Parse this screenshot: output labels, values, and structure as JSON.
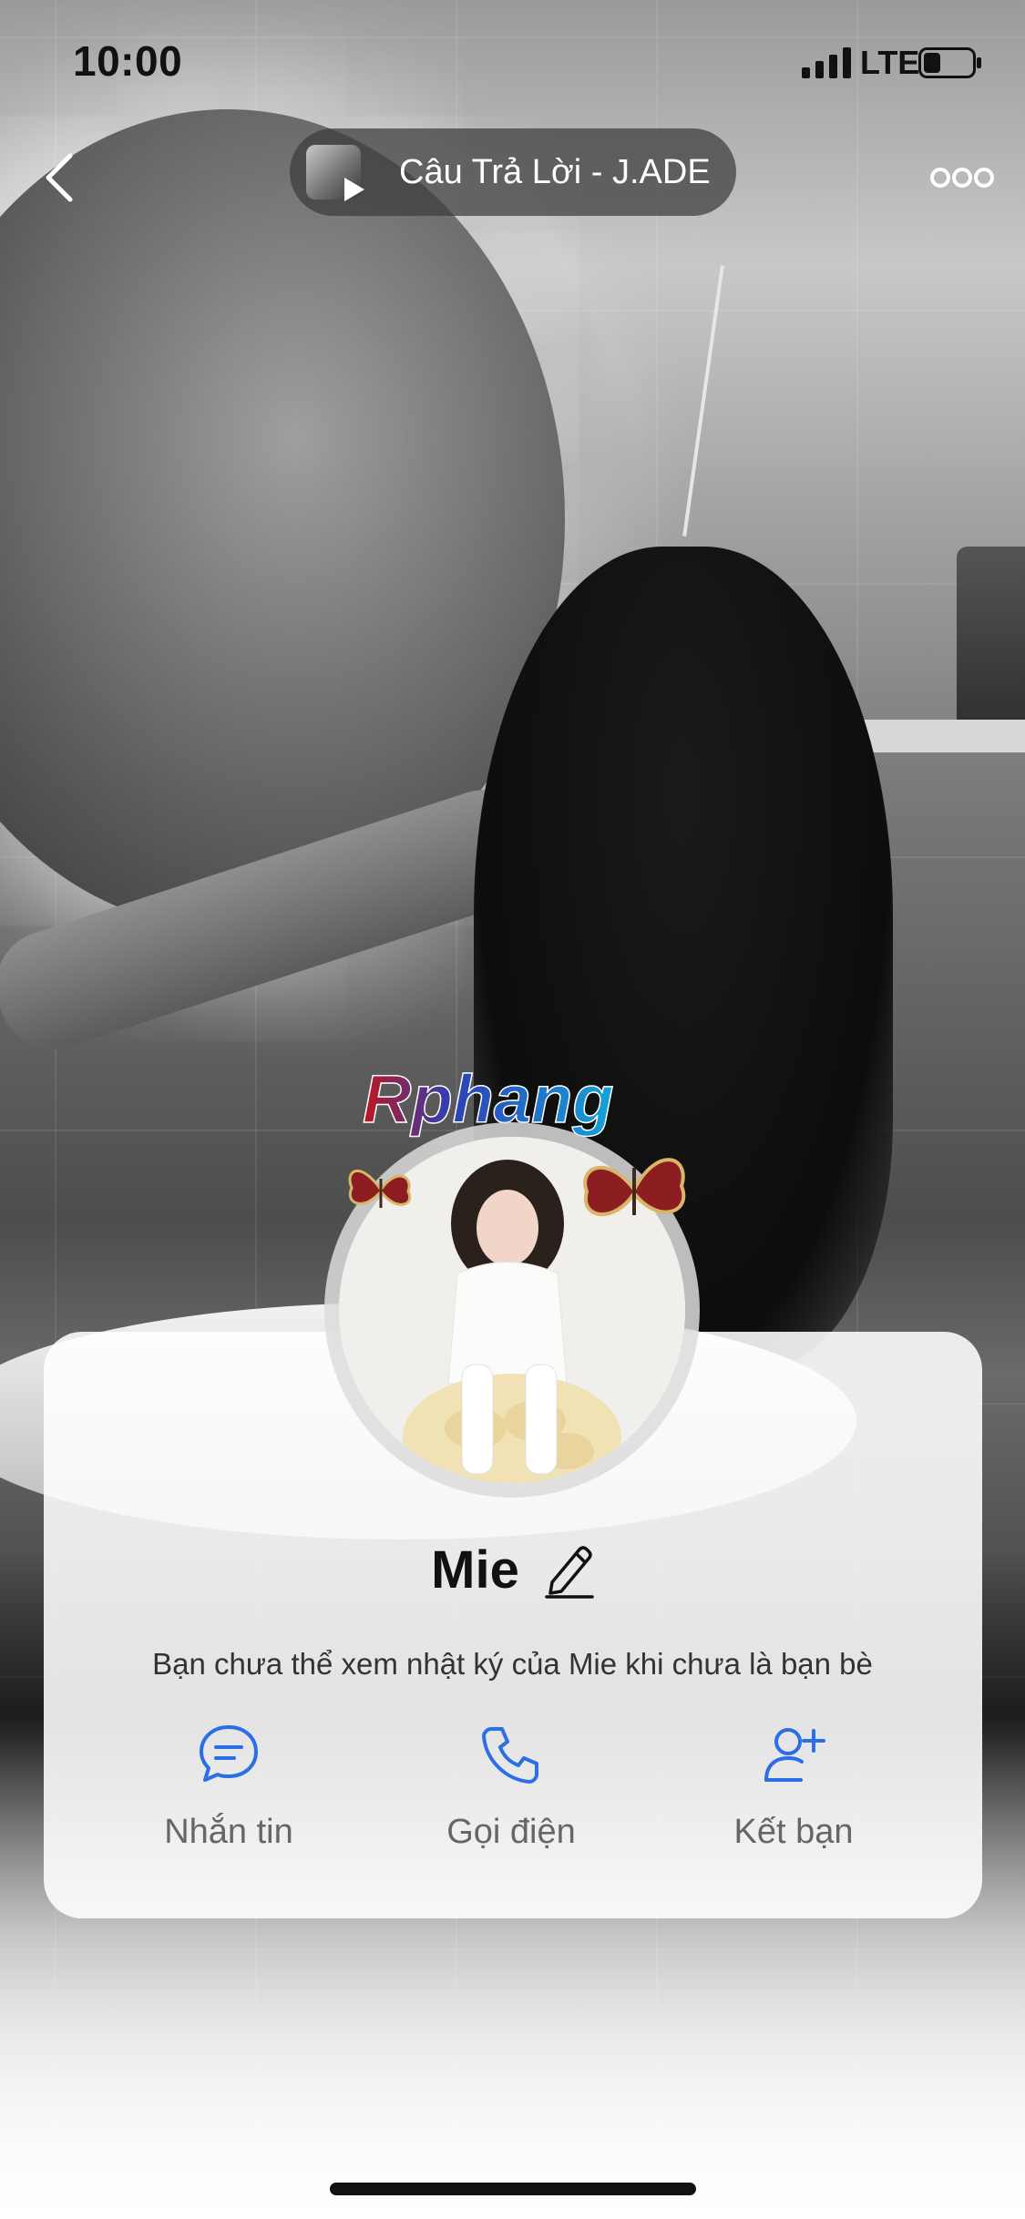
{
  "status_bar": {
    "time": "10:00",
    "network": "LTE",
    "signal_icon": "signal-bars-icon",
    "battery_icon": "battery-icon",
    "battery_level": 0.35
  },
  "top_nav": {
    "back_icon": "chevron-left-icon",
    "music": {
      "title": "Câu Trả Lời - J.ADE",
      "play_icon": "play-icon"
    },
    "more_icon": "more-dots-icon"
  },
  "watermark": {
    "text": "Rphang"
  },
  "profile": {
    "name": "Mie",
    "edit_icon": "pencil-icon",
    "privacy_note": "Bạn chưa thể xem nhật ký của Mie khi chưa là bạn bè"
  },
  "actions": {
    "message": {
      "label": "Nhắn tin",
      "icon": "chat-bubble-icon"
    },
    "call": {
      "label": "Gọi điện",
      "icon": "phone-icon"
    },
    "add_friend": {
      "label": "Kết bạn",
      "icon": "add-user-icon"
    }
  },
  "colors": {
    "accent": "#2B6FE6",
    "card_background": "#F2F2F4",
    "label_gray": "#666666"
  }
}
